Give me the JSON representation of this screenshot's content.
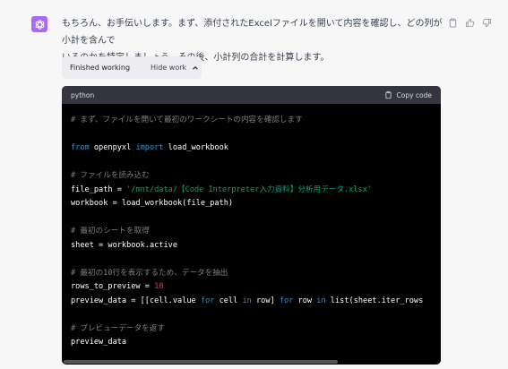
{
  "message": {
    "line1": "もちろん、お手伝いします。まず、添付されたExcelファイルを開いて内容を確認し、どの列が小計を含んで",
    "line2": "いるのかを特定しましょう。その後、小計列の合計を計算します。"
  },
  "work_toggle": {
    "status": "Finished working",
    "action": "Hide work"
  },
  "code_block": {
    "language": "python",
    "copy_label": "Copy code",
    "lines": [
      [
        {
          "t": "comment",
          "s": "# まず、ファイルを開いて最初のワークシートの内容を確認します"
        }
      ],
      [],
      [
        {
          "t": "keyword",
          "s": "from"
        },
        {
          "t": "plain",
          "s": " openpyxl "
        },
        {
          "t": "keyword",
          "s": "import"
        },
        {
          "t": "plain",
          "s": " load_workbook"
        }
      ],
      [],
      [
        {
          "t": "comment",
          "s": "# ファイルを読み込む"
        }
      ],
      [
        {
          "t": "plain",
          "s": "file_path = "
        },
        {
          "t": "string",
          "s": "'/mnt/data/【Code Interpreter入力資料】分析用データ.xlsx'"
        }
      ],
      [
        {
          "t": "plain",
          "s": "workbook = load_workbook(file_path)"
        }
      ],
      [],
      [
        {
          "t": "comment",
          "s": "# 最初のシートを取得"
        }
      ],
      [
        {
          "t": "plain",
          "s": "sheet = workbook.active"
        }
      ],
      [],
      [
        {
          "t": "comment",
          "s": "# 最初の10行を表示するため、データを抽出"
        }
      ],
      [
        {
          "t": "plain",
          "s": "rows_to_preview = "
        },
        {
          "t": "number",
          "s": "10"
        }
      ],
      [
        {
          "t": "plain",
          "s": "preview_data = [[cell.value "
        },
        {
          "t": "keyword",
          "s": "for"
        },
        {
          "t": "plain",
          "s": " cell "
        },
        {
          "t": "keyword",
          "s": "in"
        },
        {
          "t": "plain",
          "s": " row] "
        },
        {
          "t": "keyword",
          "s": "for"
        },
        {
          "t": "plain",
          "s": " row "
        },
        {
          "t": "keyword",
          "s": "in"
        },
        {
          "t": "plain",
          "s": " list(sheet.iter_rows"
        }
      ],
      [],
      [
        {
          "t": "comment",
          "s": "# プレビューデータを返す"
        }
      ],
      [
        {
          "t": "plain",
          "s": "preview_data"
        }
      ]
    ]
  },
  "icons": {
    "avatar": "openai-logo-icon",
    "copy_message": "clipboard-icon",
    "thumbs_up": "thumbs-up-icon",
    "thumbs_down": "thumbs-down-icon",
    "collapse": "chevron-up-icon",
    "copy_code": "clipboard-icon"
  },
  "colors": {
    "avatar_bg": "#ab68ff",
    "code_bg": "#000000",
    "code_header_bg": "#343541",
    "comment": "#7f7f7f",
    "keyword": "#2e95d3",
    "string": "#00a67d",
    "number": "#df3079"
  }
}
